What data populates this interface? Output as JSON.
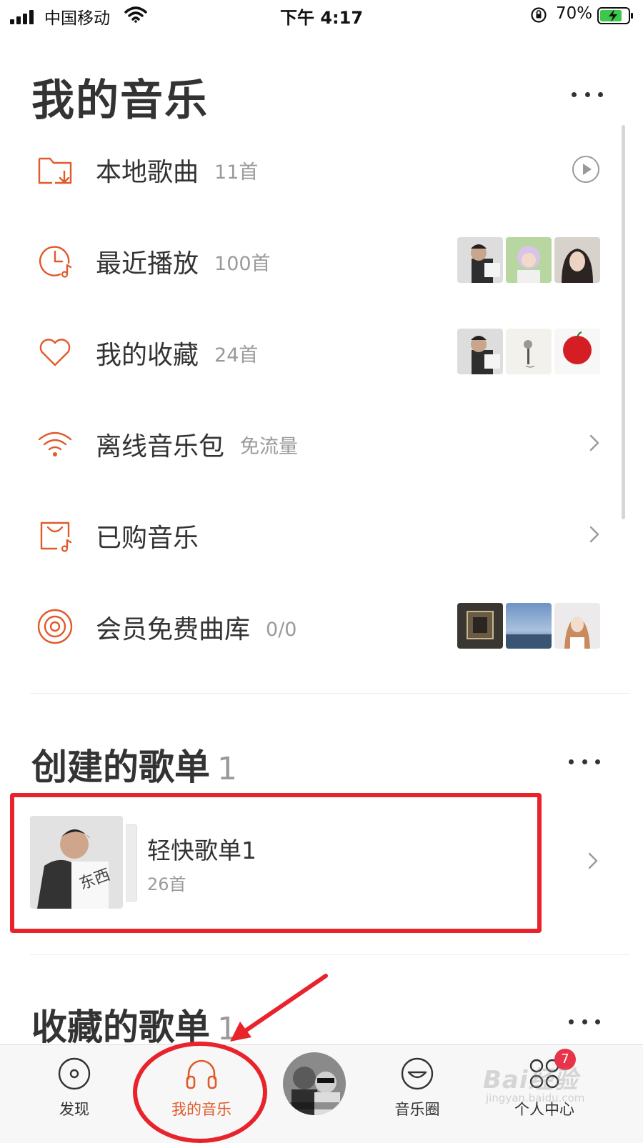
{
  "status_bar": {
    "carrier": "中国移动",
    "time": "下午 4:17",
    "battery_percent": "70%"
  },
  "header": {
    "title": "我的音乐"
  },
  "menu": [
    {
      "label": "本地歌曲",
      "count": "11首",
      "icon": "folder-download-icon",
      "trailing": "play-circle-icon"
    },
    {
      "label": "最近播放",
      "count": "100首",
      "icon": "clock-music-icon",
      "trailing": "thumbnails"
    },
    {
      "label": "我的收藏",
      "count": "24首",
      "icon": "heart-icon",
      "trailing": "thumbnails"
    },
    {
      "label": "离线音乐包",
      "count": "免流量",
      "icon": "wifi-icon",
      "trailing": "chevron-right-icon"
    },
    {
      "label": "已购音乐",
      "count": "",
      "icon": "bag-music-icon",
      "trailing": "chevron-right-icon"
    },
    {
      "label": "会员免费曲库",
      "count": "0/0",
      "icon": "disc-icon",
      "trailing": "thumbnails"
    }
  ],
  "created_playlists": {
    "title": "创建的歌单",
    "count": "1",
    "items": [
      {
        "name": "轻快歌单1",
        "count": "26首"
      }
    ]
  },
  "collected_playlists": {
    "title": "收藏的歌单",
    "count": "1"
  },
  "tab_bar": {
    "tabs": [
      {
        "label": "发现",
        "icon": "disc-icon"
      },
      {
        "label": "我的音乐",
        "icon": "headphones-icon",
        "active": true
      },
      {
        "label": "",
        "icon": "now-playing-avatar"
      },
      {
        "label": "音乐圈",
        "icon": "smile-icon"
      },
      {
        "label": "个人中心",
        "icon": "grid-icon",
        "badge": "7"
      }
    ]
  },
  "watermark": {
    "text": "Bai经验",
    "sub": "jingyan.baidu.com"
  },
  "colors": {
    "accent": "#e05a2a",
    "annotation_red": "#e8232b"
  }
}
